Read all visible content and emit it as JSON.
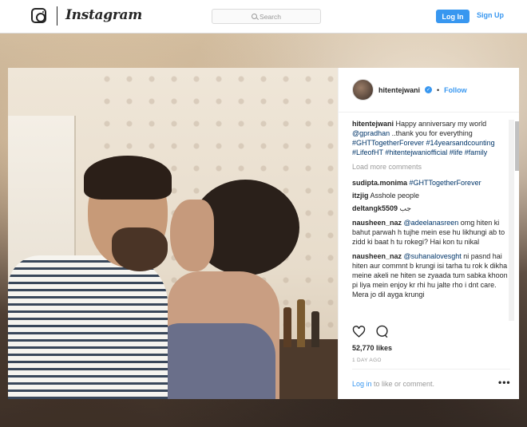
{
  "header": {
    "wordmark": "Instagram",
    "search_placeholder": "Search",
    "login_label": "Log In",
    "signup_label": "Sign Up"
  },
  "post": {
    "username": "hitentejwani",
    "follow_label": "Follow",
    "caption": {
      "user": "hitentejwani",
      "text_1": "Happy anniversary my world ",
      "mention": "@gpradhan",
      "text_2": " ..thank you for everything ",
      "tags": "#GHTTogetherForever #14yearsandcounting #LifeofHT #hitentejwaniofficial #life #family"
    },
    "load_more": "Load more comments",
    "comments": [
      {
        "user": "sudipta.monima",
        "text": "#GHTTogetherForever"
      },
      {
        "user": "itzjig",
        "text": "Asshole people"
      },
      {
        "user": "deltangk5509",
        "text": "جب"
      },
      {
        "user": "nausheen_naz",
        "mention": "@adeelanasreen",
        "text": "omg hiten ki bahut parwah h tujhe mein ese hu likhungi ab to zidd ki baat h tu rokegi? Hai kon tu nikal"
      },
      {
        "user": "nausheen_naz",
        "mention": "@suhanalovesght",
        "text": "ni pasnd hai hiten aur commnt b krungi isi tarha tu rok k dikha meine akeli ne hiten se zyaada tum sabka khoon pi liya mein enjoy kr rhi hu jalte rho i dnt care. Mera jo dil ayga krungi"
      }
    ],
    "likes": "52,770 likes",
    "time": "1 DAY AGO",
    "login_prompt_link": "Log in",
    "login_prompt_text": " to like or comment.",
    "more_label": "•••"
  },
  "colors": {
    "accent": "#3897f0",
    "text": "#262626",
    "muted": "#999999"
  }
}
